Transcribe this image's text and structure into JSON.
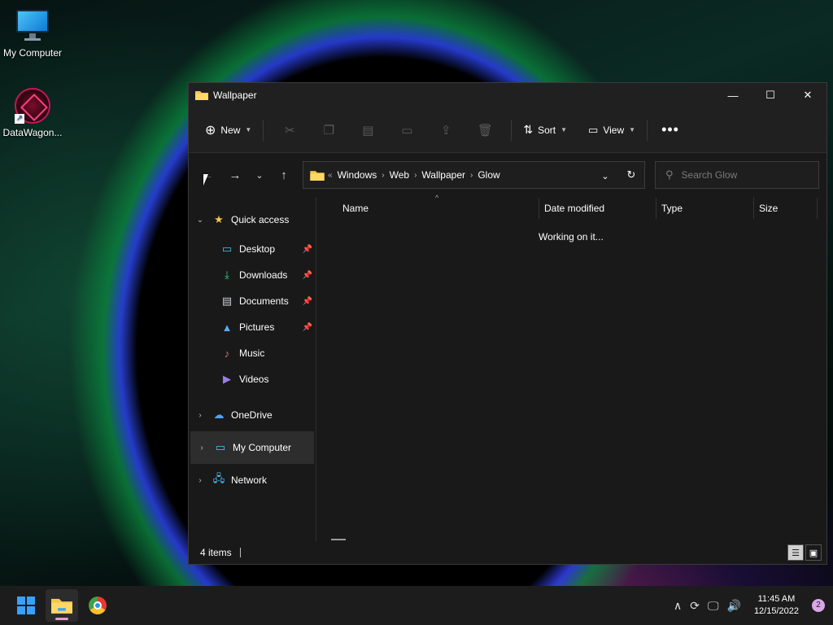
{
  "desktop": {
    "icons": [
      {
        "label": "My Computer"
      },
      {
        "label": "DataWagon..."
      }
    ]
  },
  "window": {
    "title": "Wallpaper",
    "toolbar": {
      "new_label": "New",
      "sort_label": "Sort",
      "view_label": "View"
    },
    "address": {
      "overflow": "«",
      "crumbs": [
        "Windows",
        "Web",
        "Wallpaper",
        "Glow"
      ]
    },
    "search": {
      "placeholder": "Search Glow"
    },
    "nav": {
      "quick_access": "Quick access",
      "items": [
        {
          "label": "Desktop",
          "icon": "desktop-icon"
        },
        {
          "label": "Downloads",
          "icon": "downloads-icon"
        },
        {
          "label": "Documents",
          "icon": "documents-icon"
        },
        {
          "label": "Pictures",
          "icon": "pictures-icon"
        },
        {
          "label": "Music",
          "icon": "music-icon"
        },
        {
          "label": "Videos",
          "icon": "videos-icon"
        }
      ],
      "onedrive": "OneDrive",
      "my_computer": "My Computer",
      "network": "Network"
    },
    "columns": [
      "Name",
      "Date modified",
      "Type",
      "Size"
    ],
    "status_message": "Working on it...",
    "status_bar": {
      "item_count": "4 items"
    }
  },
  "taskbar": {
    "time": "11:45 AM",
    "date": "12/15/2022",
    "notification_count": "2"
  },
  "colors": {
    "accent": "#3aa0ff",
    "folder": "#f4c84a"
  }
}
